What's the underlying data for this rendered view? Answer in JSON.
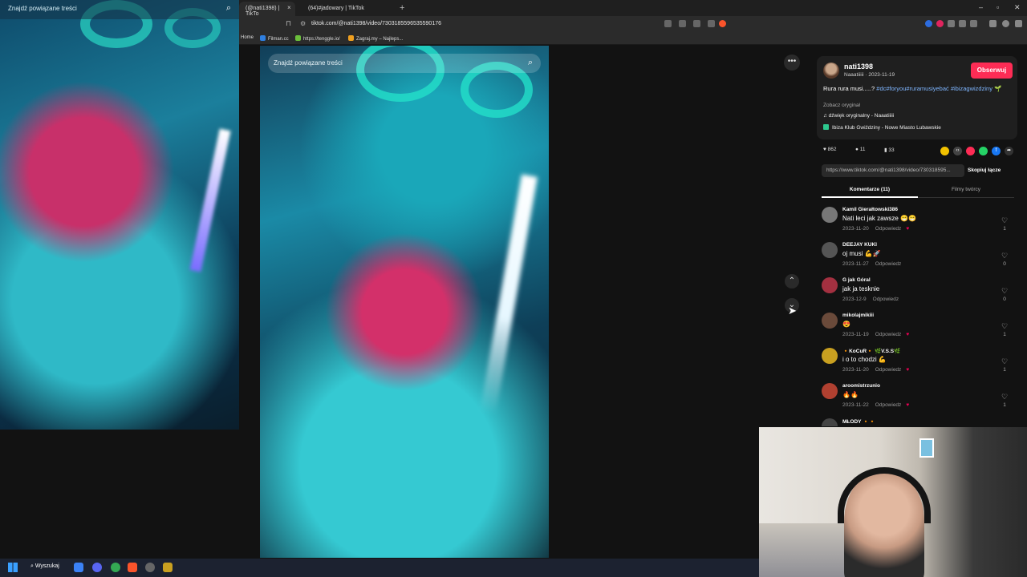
{
  "background_video": {
    "search_placeholder": "Znajdź powiązane treści",
    "search_icon": "search-icon"
  },
  "browser": {
    "tabs": [
      {
        "label": "(@nati1398) | TikTo",
        "close": "×",
        "active": true
      },
      {
        "label": "(64)#jadowary | TikTok",
        "close": "",
        "active": false
      }
    ],
    "new_tab": "+",
    "window_controls": [
      "–",
      "▫",
      "✕"
    ],
    "url": "tiktok.com/@nati1398/video/7303185596535590176",
    "bookmarks": [
      {
        "label": "Home",
        "color": "#444444"
      },
      {
        "label": "Filman.cc",
        "color": "#2f7fe0"
      },
      {
        "label": "https://tenggle.io/",
        "color": "#6bbf3b"
      },
      {
        "label": "Zagraj.my – Najleps...",
        "color": "#f0a020"
      }
    ]
  },
  "player": {
    "search_placeholder": "Znajdź powiązane treści",
    "more": "•••",
    "nav_up": "⌃",
    "nav_down": "⌄"
  },
  "author": {
    "username": "nati1398",
    "subtitle": "Naaatiiiii · 2023-11-19",
    "follow_label": "Obserwuj",
    "description_text": "Rura rura musi.....? ",
    "description_tags": "#dc#foryou#ruramusiyebać #ibizagwizdziny",
    "description_emoji": "🌱",
    "see_original": "Zobacz oryginał",
    "sound": "♫  dźwięk oryginalny - Naaatiiiii",
    "location": "Ibiza Klub Gwiździny - Nowe Miasto Lubawskie"
  },
  "stats": {
    "likes": "862",
    "comments": "11",
    "saves": "33"
  },
  "share": {
    "link": "https://www.tiktok.com/@nati1398/video/730318595...",
    "copy_label": "Skopiuj łącze",
    "icons": [
      {
        "name": "emoji-share-icon",
        "color": "#f2c200"
      },
      {
        "name": "embed-icon",
        "color": "#444444"
      },
      {
        "name": "send-friends-icon",
        "color": "#fe2c55"
      },
      {
        "name": "whatsapp-icon",
        "color": "#25d366"
      },
      {
        "name": "facebook-icon",
        "color": "#1877f2"
      },
      {
        "name": "share-arrow-icon",
        "color": "#333333"
      }
    ]
  },
  "comments_tab": {
    "comments_label": "Komentarze (11)",
    "creator_label": "Filmy twórcy"
  },
  "comments": [
    {
      "user": "Kamil Gierałtowski386",
      "text": "Nati leci jak zawsze 😁😁",
      "date": "2023-11-20",
      "reply": "Odpowiedz",
      "liked_by_creator": true,
      "likes": "1",
      "avatar": "#777777"
    },
    {
      "user": "DEEJAY KUKI",
      "text": "oj musi 💪🚀",
      "date": "2023-11-27",
      "reply": "Odpowiedz",
      "liked_by_creator": false,
      "likes": "0",
      "avatar": "#555555"
    },
    {
      "user": "G jak Góral",
      "text": "jak ja tesknie",
      "date": "2023-12-9",
      "reply": "Odpowiedz",
      "liked_by_creator": false,
      "likes": "0",
      "avatar": "#a33040"
    },
    {
      "user": "mikolajmikiii",
      "text": "😍",
      "date": "2023-11-19",
      "reply": "Odpowiedz",
      "liked_by_creator": true,
      "likes": "1",
      "avatar": "#6a4a3a"
    },
    {
      "user": "🔸KoCuR🔸 🌿V.S.S🌿",
      "text": "i o to chodzi 💪",
      "date": "2023-11-20",
      "reply": "Odpowiedz",
      "liked_by_creator": true,
      "likes": "1",
      "avatar": "#c9a020"
    },
    {
      "user": "aroomistrzunio",
      "text": "🔥🔥",
      "date": "2023-11-22",
      "reply": "Odpowiedz",
      "liked_by_creator": true,
      "likes": "1",
      "avatar": "#b04030"
    },
    {
      "user": "MŁODY 🔸🔸",
      "text": "",
      "date": "",
      "reply": "",
      "liked_by_creator": false,
      "likes": "",
      "avatar": "#444444"
    }
  ],
  "taskbar": {
    "search_label": "Wyszukaj",
    "start_icon": "windows-start-icon",
    "apps": [
      {
        "name": "file-explorer-icon",
        "color": "#3b82f6"
      },
      {
        "name": "discord-icon",
        "color": "#5865f2"
      },
      {
        "name": "chrome-icon",
        "color": "#34a853"
      },
      {
        "name": "brave-icon",
        "color": "#fb542b"
      },
      {
        "name": "obs-icon",
        "color": "#666666"
      },
      {
        "name": "app-icon",
        "color": "#c9a020"
      }
    ]
  }
}
